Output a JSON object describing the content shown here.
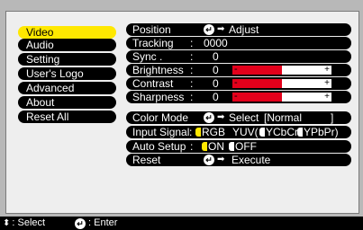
{
  "menu": {
    "items": [
      {
        "label": "Video",
        "active": true
      },
      {
        "label": "Audio"
      },
      {
        "label": "Setting"
      },
      {
        "label": "User's Logo"
      },
      {
        "label": "Advanced"
      },
      {
        "label": "About"
      },
      {
        "label": "Reset All"
      }
    ]
  },
  "settings": {
    "position": {
      "label": "Position",
      "action": "Adjust"
    },
    "tracking": {
      "label": "Tracking",
      "value": "0000"
    },
    "sync": {
      "label": "Sync .",
      "value": "0"
    },
    "brightness": {
      "label": "Brightness",
      "value": "0",
      "level": 0.5
    },
    "contrast": {
      "label": "Contrast",
      "value": "0",
      "level": 0.5
    },
    "sharpness": {
      "label": "Sharpness",
      "value": "0",
      "level": 0.5
    },
    "color_mode": {
      "label": "Color Mode",
      "action": "Select",
      "current": "[Normal",
      "close_bracket": "]"
    },
    "input_signal": {
      "label": "Input Signal",
      "options": [
        "RGB",
        "YUV(",
        "YCbCr",
        "YPbPr)"
      ]
    },
    "auto_setup": {
      "label": "Auto Setup",
      "options": [
        "ON",
        "OFF"
      ]
    },
    "reset": {
      "label": "Reset",
      "action": "Execute"
    }
  },
  "status_bar": {
    "select_label": ": Select",
    "enter_label": ": Enter"
  },
  "colors": {
    "accent_yellow": "#ffe800",
    "bar_red": "#e3001b",
    "background": "#eeeeee"
  }
}
